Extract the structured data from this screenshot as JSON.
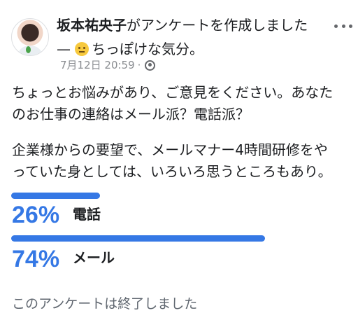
{
  "post": {
    "author": "坂本祐央子",
    "action": "がアンケートを作成しました",
    "feeling_prefix": "—",
    "feeling": "ちっぽけな気分。",
    "feeling_icon": "slightly-frowning-emoji",
    "timestamp": "7月12日 20:59",
    "separator": "·",
    "privacy_icon": "globe-icon"
  },
  "body": {
    "lines": [
      "ちょっとお悩みがあり、ご意見をください。あなた",
      "のお仕事の連絡はメール派？電話派？",
      "企業様からの要望で、メールマナー4時間研修をや",
      "っていた身としては、いろいろ思うところもあり。"
    ]
  },
  "poll": {
    "accent_color": "#3578e5",
    "options": [
      {
        "label": "電話",
        "percent_text": "26%",
        "share": 0.26
      },
      {
        "label": "メール",
        "percent_text": "74%",
        "share": 0.74
      }
    ],
    "status": "このアンケートは終了しました"
  }
}
